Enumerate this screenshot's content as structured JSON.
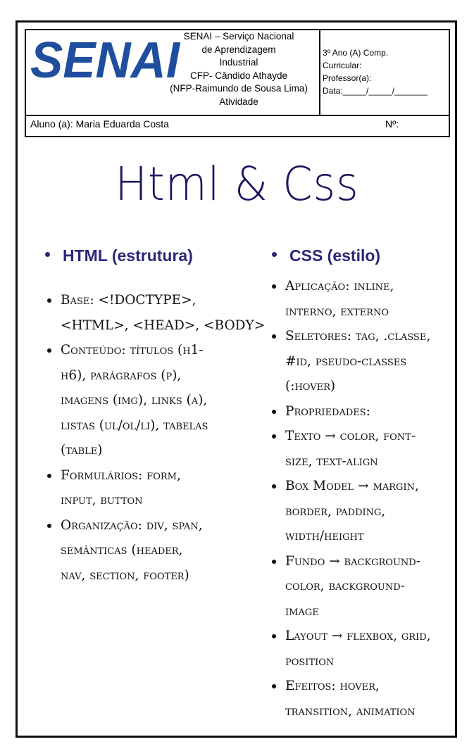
{
  "header": {
    "logo_text": "SENAI",
    "institution_lines": [
      "SENAI – Serviço Nacional",
      "de Aprendizagem",
      "Industrial",
      "CFP- Cândido Athayde",
      "(NFP-Raimundo de Sousa Lima)",
      "Atividade"
    ],
    "info_lines": [
      "3º Ano (A) Comp.",
      "Curricular:",
      "Professor(a):",
      "Data:_____/_____/_______"
    ],
    "student": "Aluno (a): Maria Eduarda Costa",
    "number_label": "Nº:"
  },
  "title": "Html & Css",
  "html_column": {
    "heading": "HTML (estrutura)",
    "items": [
      [
        "Base: <!DOCTYPE>,",
        "<HTML>, <HEAD>, <BODY>"
      ],
      [
        "Conteúdo: títulos (h1-",
        "h6), parágrafos (p),",
        "imagens (img), links (a),",
        "listas (ul/ol/li), tabelas",
        "(table)"
      ],
      [
        "Formulários: form,",
        "input, button"
      ],
      [
        "Organização: div, span,",
        "semânticas (header,",
        "nav, section, footer)"
      ]
    ]
  },
  "css_column": {
    "heading": "CSS (estilo)",
    "items": [
      [
        "Aplicação: inline,",
        "interno, externo"
      ],
      [
        "Seletores: tag, .classe,",
        "#id, pseudo-classes",
        "(:hover)"
      ],
      [
        "Propriedades:"
      ],
      [
        "Texto → color, font-",
        "size, text-align"
      ],
      [
        "Box Model → margin,",
        "border, padding,",
        "width/height"
      ],
      [
        "Fundo → background-",
        "color, background-",
        "image"
      ],
      [
        "Layout → flexbox, grid,",
        "position"
      ],
      [
        "Efeitos: hover,",
        "transition, animation"
      ]
    ]
  },
  "colors": {
    "brand_blue": "#1f4e9e",
    "heading_navy": "#2a2878",
    "title_navy": "#1a1860"
  }
}
